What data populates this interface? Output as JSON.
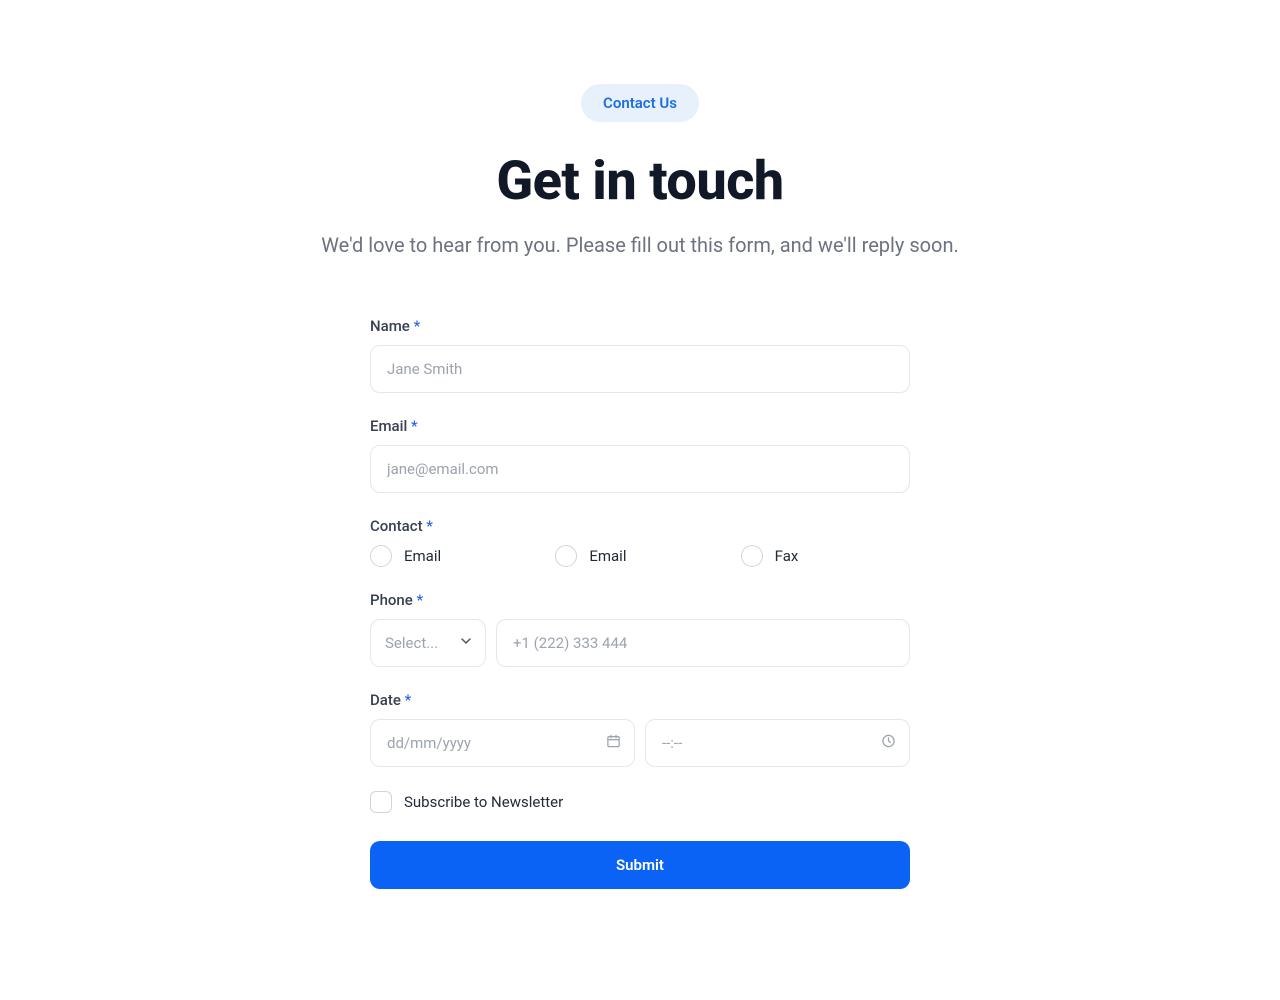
{
  "header": {
    "pill": "Contact Us",
    "title": "Get in touch",
    "subtitle": "We'd love to hear from you. Please fill out this form, and we'll reply soon."
  },
  "form": {
    "name": {
      "label": "Name",
      "required_mark": "*",
      "placeholder": "Jane Smith",
      "value": ""
    },
    "email": {
      "label": "Email",
      "required_mark": "*",
      "placeholder": "jane@email.com",
      "value": ""
    },
    "contact": {
      "label": "Contact",
      "required_mark": "*",
      "options": [
        {
          "label": "Email"
        },
        {
          "label": "Email"
        },
        {
          "label": "Fax"
        }
      ]
    },
    "phone": {
      "label": "Phone",
      "required_mark": "*",
      "select_placeholder": "Select...",
      "placeholder": "+1 (222) 333 444",
      "value": ""
    },
    "date": {
      "label": "Date",
      "required_mark": "*",
      "date_placeholder": "dd/mm/yyyy",
      "time_placeholder": "--:--",
      "date_value": "",
      "time_value": ""
    },
    "newsletter": {
      "label": "Subscribe to Newsletter"
    },
    "submit_label": "Submit"
  }
}
